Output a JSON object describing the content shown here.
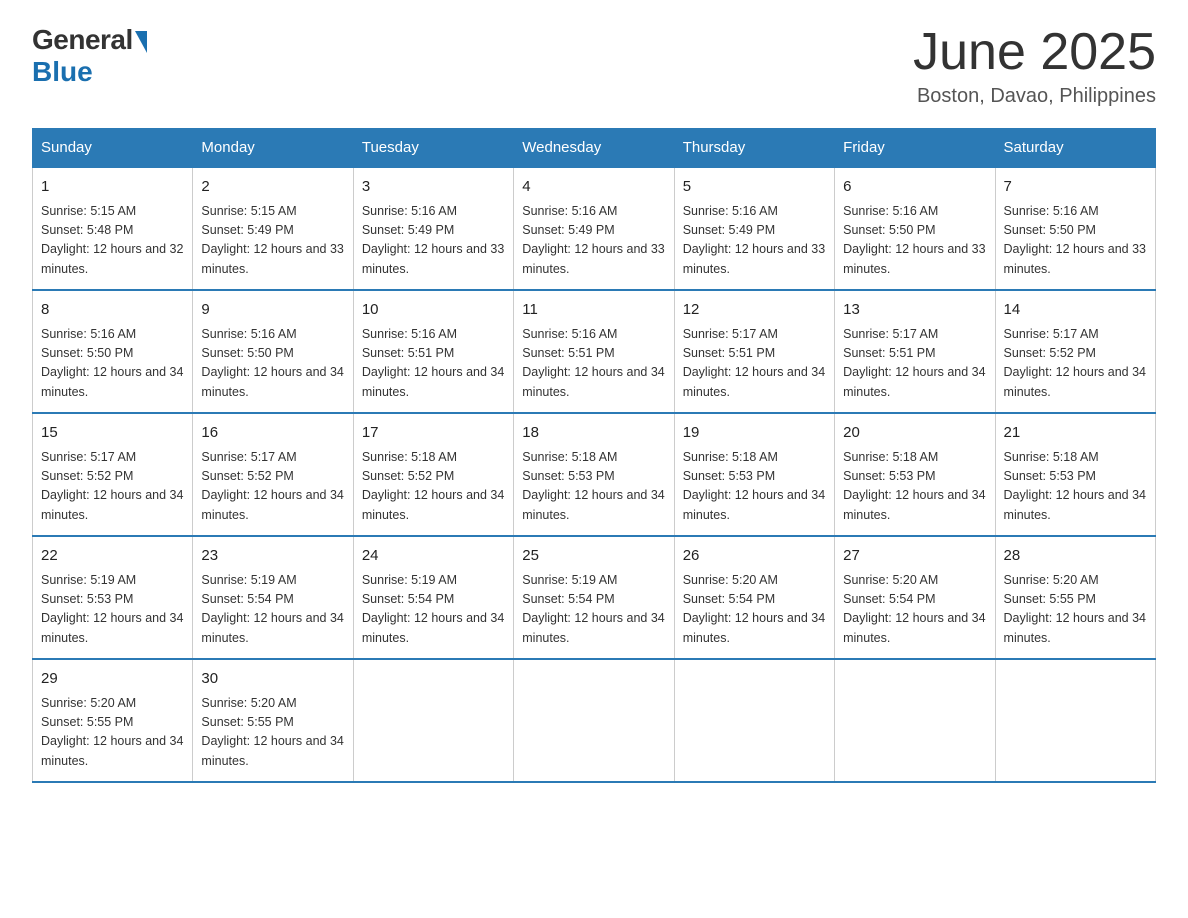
{
  "logo": {
    "general": "General",
    "blue": "Blue"
  },
  "header": {
    "month": "June 2025",
    "location": "Boston, Davao, Philippines"
  },
  "days_of_week": [
    "Sunday",
    "Monday",
    "Tuesday",
    "Wednesday",
    "Thursday",
    "Friday",
    "Saturday"
  ],
  "weeks": [
    [
      {
        "day": "1",
        "sunrise": "5:15 AM",
        "sunset": "5:48 PM",
        "daylight": "12 hours and 32 minutes."
      },
      {
        "day": "2",
        "sunrise": "5:15 AM",
        "sunset": "5:49 PM",
        "daylight": "12 hours and 33 minutes."
      },
      {
        "day": "3",
        "sunrise": "5:16 AM",
        "sunset": "5:49 PM",
        "daylight": "12 hours and 33 minutes."
      },
      {
        "day": "4",
        "sunrise": "5:16 AM",
        "sunset": "5:49 PM",
        "daylight": "12 hours and 33 minutes."
      },
      {
        "day": "5",
        "sunrise": "5:16 AM",
        "sunset": "5:49 PM",
        "daylight": "12 hours and 33 minutes."
      },
      {
        "day": "6",
        "sunrise": "5:16 AM",
        "sunset": "5:50 PM",
        "daylight": "12 hours and 33 minutes."
      },
      {
        "day": "7",
        "sunrise": "5:16 AM",
        "sunset": "5:50 PM",
        "daylight": "12 hours and 33 minutes."
      }
    ],
    [
      {
        "day": "8",
        "sunrise": "5:16 AM",
        "sunset": "5:50 PM",
        "daylight": "12 hours and 34 minutes."
      },
      {
        "day": "9",
        "sunrise": "5:16 AM",
        "sunset": "5:50 PM",
        "daylight": "12 hours and 34 minutes."
      },
      {
        "day": "10",
        "sunrise": "5:16 AM",
        "sunset": "5:51 PM",
        "daylight": "12 hours and 34 minutes."
      },
      {
        "day": "11",
        "sunrise": "5:16 AM",
        "sunset": "5:51 PM",
        "daylight": "12 hours and 34 minutes."
      },
      {
        "day": "12",
        "sunrise": "5:17 AM",
        "sunset": "5:51 PM",
        "daylight": "12 hours and 34 minutes."
      },
      {
        "day": "13",
        "sunrise": "5:17 AM",
        "sunset": "5:51 PM",
        "daylight": "12 hours and 34 minutes."
      },
      {
        "day": "14",
        "sunrise": "5:17 AM",
        "sunset": "5:52 PM",
        "daylight": "12 hours and 34 minutes."
      }
    ],
    [
      {
        "day": "15",
        "sunrise": "5:17 AM",
        "sunset": "5:52 PM",
        "daylight": "12 hours and 34 minutes."
      },
      {
        "day": "16",
        "sunrise": "5:17 AM",
        "sunset": "5:52 PM",
        "daylight": "12 hours and 34 minutes."
      },
      {
        "day": "17",
        "sunrise": "5:18 AM",
        "sunset": "5:52 PM",
        "daylight": "12 hours and 34 minutes."
      },
      {
        "day": "18",
        "sunrise": "5:18 AM",
        "sunset": "5:53 PM",
        "daylight": "12 hours and 34 minutes."
      },
      {
        "day": "19",
        "sunrise": "5:18 AM",
        "sunset": "5:53 PM",
        "daylight": "12 hours and 34 minutes."
      },
      {
        "day": "20",
        "sunrise": "5:18 AM",
        "sunset": "5:53 PM",
        "daylight": "12 hours and 34 minutes."
      },
      {
        "day": "21",
        "sunrise": "5:18 AM",
        "sunset": "5:53 PM",
        "daylight": "12 hours and 34 minutes."
      }
    ],
    [
      {
        "day": "22",
        "sunrise": "5:19 AM",
        "sunset": "5:53 PM",
        "daylight": "12 hours and 34 minutes."
      },
      {
        "day": "23",
        "sunrise": "5:19 AM",
        "sunset": "5:54 PM",
        "daylight": "12 hours and 34 minutes."
      },
      {
        "day": "24",
        "sunrise": "5:19 AM",
        "sunset": "5:54 PM",
        "daylight": "12 hours and 34 minutes."
      },
      {
        "day": "25",
        "sunrise": "5:19 AM",
        "sunset": "5:54 PM",
        "daylight": "12 hours and 34 minutes."
      },
      {
        "day": "26",
        "sunrise": "5:20 AM",
        "sunset": "5:54 PM",
        "daylight": "12 hours and 34 minutes."
      },
      {
        "day": "27",
        "sunrise": "5:20 AM",
        "sunset": "5:54 PM",
        "daylight": "12 hours and 34 minutes."
      },
      {
        "day": "28",
        "sunrise": "5:20 AM",
        "sunset": "5:55 PM",
        "daylight": "12 hours and 34 minutes."
      }
    ],
    [
      {
        "day": "29",
        "sunrise": "5:20 AM",
        "sunset": "5:55 PM",
        "daylight": "12 hours and 34 minutes."
      },
      {
        "day": "30",
        "sunrise": "5:20 AM",
        "sunset": "5:55 PM",
        "daylight": "12 hours and 34 minutes."
      },
      null,
      null,
      null,
      null,
      null
    ]
  ]
}
